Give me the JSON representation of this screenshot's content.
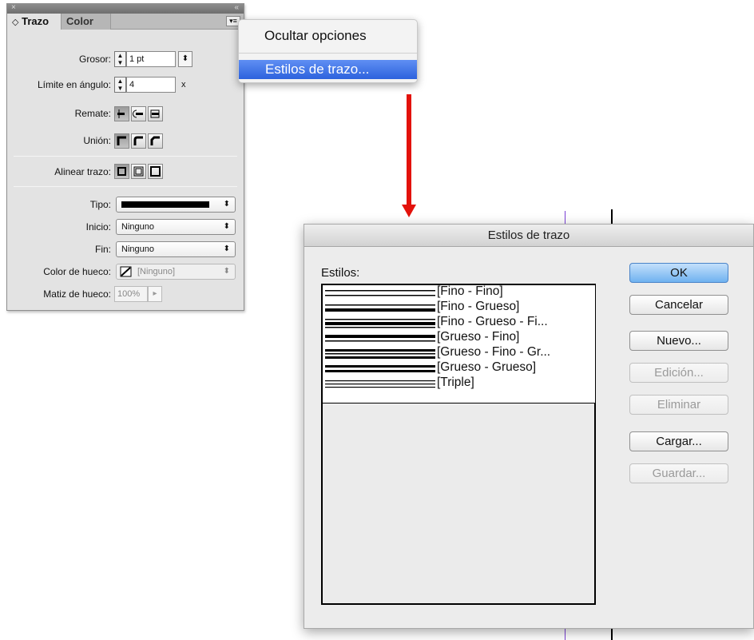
{
  "panel": {
    "close_glyph": "×",
    "collapse_glyph": "«",
    "tabs": [
      {
        "label": "Trazo",
        "prefix": "◇"
      },
      {
        "label": "Color"
      }
    ],
    "menu_glyph": "▾≡",
    "grosor": {
      "label": "Grosor:",
      "value": "1 pt"
    },
    "limite": {
      "label": "Límite en ángulo:",
      "value": "4",
      "suffix": "x"
    },
    "remate": {
      "label": "Remate:"
    },
    "union": {
      "label": "Unión:"
    },
    "alinear": {
      "label": "Alinear trazo:"
    },
    "tipo": {
      "label": "Tipo:"
    },
    "inicio": {
      "label": "Inicio:",
      "value": "Ninguno"
    },
    "fin": {
      "label": "Fin:",
      "value": "Ninguno"
    },
    "color_hueco": {
      "label": "Color de hueco:",
      "value": "[Ninguno]"
    },
    "matiz_hueco": {
      "label": "Matiz de hueco:",
      "value": "100%"
    }
  },
  "popup_menu": {
    "items": [
      {
        "label": "Ocultar opciones"
      },
      {
        "label": "Estilos de trazo...",
        "highlighted": true
      }
    ],
    "highlight_color": "#3a6fe6"
  },
  "arrow_color": "#e3120b",
  "dialog": {
    "title": "Estilos de trazo",
    "list_label": "Estilos:",
    "styles": [
      {
        "label": "[Fino - Fino]"
      },
      {
        "label": "[Fino - Grueso]"
      },
      {
        "label": "[Fino - Grueso - Fi..."
      },
      {
        "label": "[Grueso - Fino]"
      },
      {
        "label": "[Grueso - Fino - Gr..."
      },
      {
        "label": "[Grueso - Grueso]"
      },
      {
        "label": "[Triple]"
      }
    ],
    "buttons": {
      "ok": "OK",
      "cancel": "Cancelar",
      "new": "Nuevo...",
      "edit": "Edición...",
      "delete": "Eliminar",
      "load": "Cargar...",
      "save": "Guardar..."
    }
  }
}
